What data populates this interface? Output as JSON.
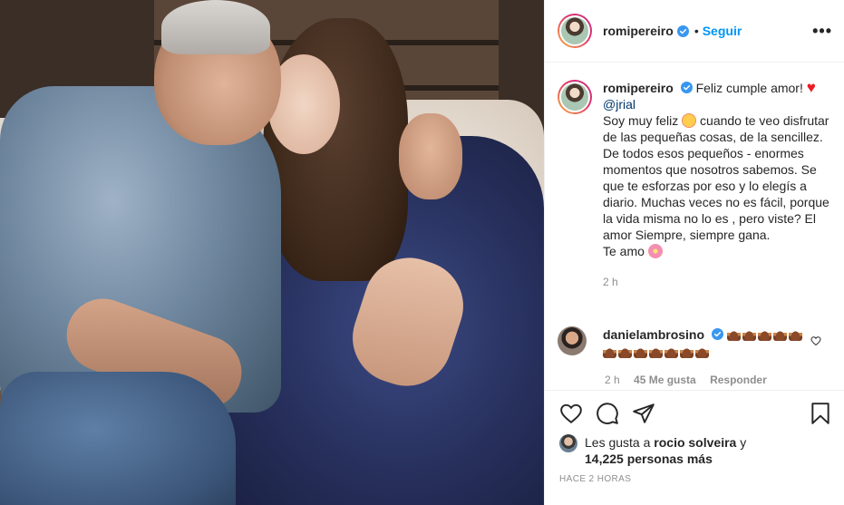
{
  "post": {
    "author": "romipereiro",
    "follow_label": "Seguir",
    "separator": "•",
    "more_label": "•••"
  },
  "caption": {
    "author": "romipereiro",
    "line1": " Feliz cumple amor! ",
    "mention": "@jrial",
    "text_a": "Soy muy feliz ",
    "text_b": "cuando te veo disfrutar de las pequeñas cosas, de la sencillez. De todos esos pequeños - enormes momentos que nosotros sabemos. Se que te esforzas por eso y lo elegís a diario. Muchas veces no es fácil, porque la vida misma no lo es , pero viste? El amor Siempre, siempre gana.",
    "text_c": "Te amo ",
    "time": "2 h"
  },
  "comment": {
    "author": "danielambrosino",
    "time": "2 h",
    "likes": "45 Me gusta",
    "reply": "Responder"
  },
  "likes": {
    "prefix": "Les gusta a ",
    "user": "rocio solveira",
    "and": " y",
    "count": "14,225 personas más"
  },
  "timestamp": "HACE 2 HORAS",
  "icons": [
    "heart-icon",
    "comment-icon",
    "share-icon",
    "bookmark-icon",
    "verified-icon",
    "kebab-icon"
  ],
  "colors": {
    "accent": "#0095f6",
    "verified": "#3897f0",
    "heart": "#ed1c24",
    "muted": "#8e8e8e"
  }
}
